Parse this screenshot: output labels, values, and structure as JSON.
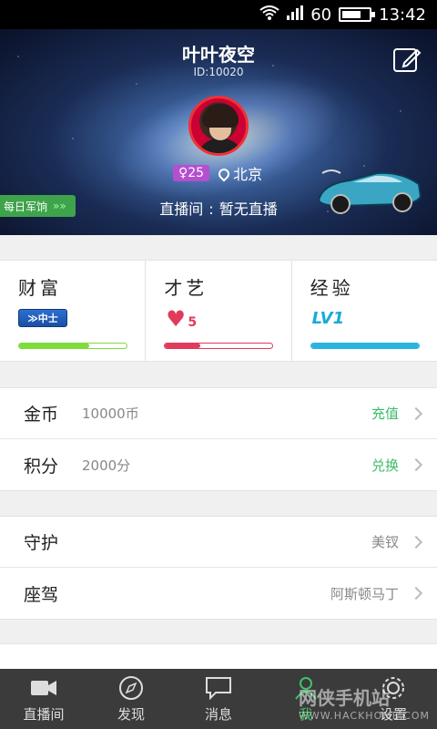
{
  "status_bar": {
    "signal": "60",
    "time": "13:42"
  },
  "profile": {
    "name": "叶叶夜空",
    "id": "ID:10020",
    "gender_age": "♀25",
    "location": "北京",
    "live_label": "直播间",
    "live_sep": ":",
    "live_status": "暂无直播",
    "daily_button": "每日军饷"
  },
  "stats": [
    {
      "label": "财富",
      "badge": "中士",
      "bar_color": "#7ddc3a",
      "progress": 0.65
    },
    {
      "label": "才艺",
      "badge": "5",
      "bar_color": "#e23a5b",
      "progress": 0.33
    },
    {
      "label": "经验",
      "badge": "LV1",
      "bar_color": "#2ab4de",
      "progress": 1.0
    }
  ],
  "group1": [
    {
      "name": "金币",
      "value": "10000币",
      "action": "充值"
    },
    {
      "name": "积分",
      "value": "2000分",
      "action": "兑换"
    }
  ],
  "group2": [
    {
      "name": "守护",
      "right": "美钗"
    },
    {
      "name": "座驾",
      "right": "阿斯顿马丁"
    }
  ],
  "tabs": [
    {
      "label": "直播间",
      "icon": "video-camera-icon"
    },
    {
      "label": "发现",
      "icon": "compass-icon"
    },
    {
      "label": "消息",
      "icon": "chat-bubble-icon"
    },
    {
      "label": "我",
      "icon": "person-icon"
    },
    {
      "label": "设置",
      "icon": "gear-icon"
    }
  ],
  "watermark": {
    "main": "网侠手机站",
    "url": "WWW.HACKHOME.COM"
  },
  "colors": {
    "accent_green": "#3fc46a",
    "tabbar": "#3b3b3b"
  }
}
